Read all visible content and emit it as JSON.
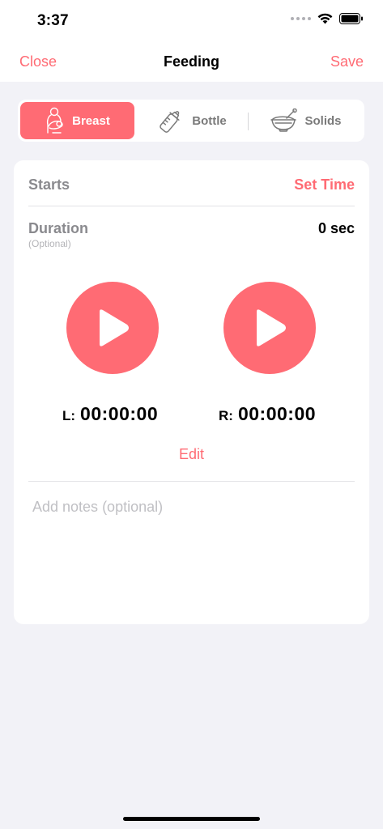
{
  "status_bar": {
    "time": "3:37",
    "icons": [
      "signal-dots-icon",
      "wifi-icon",
      "battery-icon"
    ]
  },
  "nav": {
    "close_label": "Close",
    "title": "Feeding",
    "save_label": "Save"
  },
  "segments": [
    {
      "label": "Breast",
      "icon": "breastfeeding-icon",
      "active": true
    },
    {
      "label": "Bottle",
      "icon": "baby-bottle-icon",
      "active": false
    },
    {
      "label": "Solids",
      "icon": "food-bowl-icon",
      "active": false
    }
  ],
  "form": {
    "starts_label": "Starts",
    "set_time_label": "Set Time",
    "duration_label": "Duration",
    "duration_hint": "(Optional)",
    "duration_value": "0 sec"
  },
  "timers": {
    "left": {
      "prefix": "L:",
      "value": "00:00:00"
    },
    "right": {
      "prefix": "R:",
      "value": "00:00:00"
    }
  },
  "edit_label": "Edit",
  "notes": {
    "placeholder": "Add notes (optional)",
    "value": ""
  },
  "colors": {
    "accent": "#ff6b74",
    "background": "#f2f2f7",
    "card": "#ffffff",
    "secondary_text": "#8a8a8e"
  }
}
